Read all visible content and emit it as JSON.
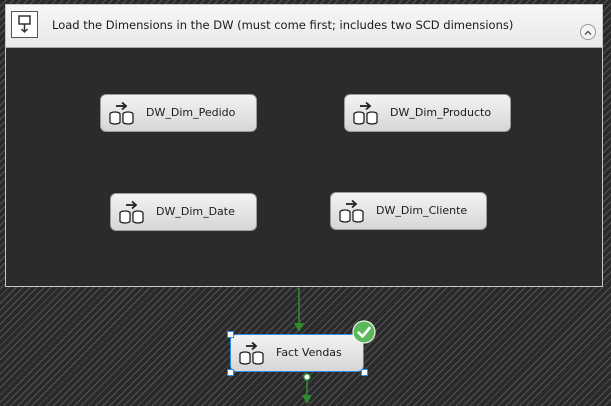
{
  "container": {
    "title": "Load the Dimensions in the DW (must come first; includes two SCD dimensions)",
    "icon": "sequence-container-icon",
    "collapse_icon": "collapse-up-icon"
  },
  "tasks": [
    {
      "label": "DW_Dim_Pedido",
      "icon": "data-flow-task-icon"
    },
    {
      "label": "DW_Dim_Producto",
      "icon": "data-flow-task-icon"
    },
    {
      "label": "DW_Dim_Date",
      "icon": "data-flow-task-icon"
    },
    {
      "label": "DW_Dim_Cliente",
      "icon": "data-flow-task-icon"
    }
  ],
  "fact_task": {
    "label": "Fact Vendas",
    "icon": "data-flow-task-icon",
    "status": "success",
    "status_icon": "success-check-icon"
  },
  "colors": {
    "precedence_constraint": "#2e8b2e",
    "selection": "#2d8ce6",
    "success": "#5cb85c"
  }
}
